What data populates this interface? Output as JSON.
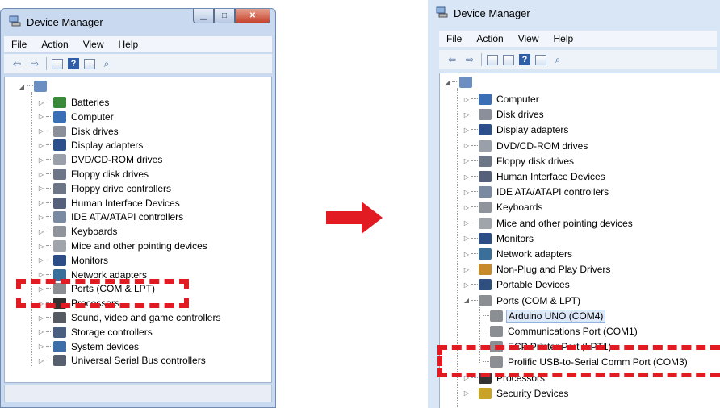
{
  "window": {
    "title": "Device Manager"
  },
  "menu": [
    "File",
    "Action",
    "View",
    "Help"
  ],
  "left_tree": {
    "items": [
      {
        "label": "Batteries",
        "icon": "battery-icon"
      },
      {
        "label": "Computer",
        "icon": "computer-icon"
      },
      {
        "label": "Disk drives",
        "icon": "disk-drive-icon"
      },
      {
        "label": "Display adapters",
        "icon": "display-adapter-icon"
      },
      {
        "label": "DVD/CD-ROM drives",
        "icon": "dvd-drive-icon"
      },
      {
        "label": "Floppy disk drives",
        "icon": "floppy-drive-icon"
      },
      {
        "label": "Floppy drive controllers",
        "icon": "floppy-controller-icon"
      },
      {
        "label": "Human Interface Devices",
        "icon": "hid-icon"
      },
      {
        "label": "IDE ATA/ATAPI controllers",
        "icon": "ide-controller-icon"
      },
      {
        "label": "Keyboards",
        "icon": "keyboard-icon"
      },
      {
        "label": "Mice and other pointing devices",
        "icon": "mouse-icon"
      },
      {
        "label": "Monitors",
        "icon": "monitor-icon"
      },
      {
        "label": "Network adapters",
        "icon": "network-adapter-icon"
      },
      {
        "label": "Ports (COM & LPT)",
        "icon": "port-icon"
      },
      {
        "label": "Processors",
        "icon": "processor-icon"
      },
      {
        "label": "Sound, video and game controllers",
        "icon": "sound-icon"
      },
      {
        "label": "Storage controllers",
        "icon": "storage-controller-icon"
      },
      {
        "label": "System devices",
        "icon": "system-devices-icon"
      },
      {
        "label": "Universal Serial Bus controllers",
        "icon": "usb-icon"
      }
    ]
  },
  "right_tree": {
    "items": [
      {
        "label": "Computer",
        "icon": "computer-icon"
      },
      {
        "label": "Disk drives",
        "icon": "disk-drive-icon"
      },
      {
        "label": "Display adapters",
        "icon": "display-adapter-icon"
      },
      {
        "label": "DVD/CD-ROM drives",
        "icon": "dvd-drive-icon"
      },
      {
        "label": "Floppy disk drives",
        "icon": "floppy-drive-icon"
      },
      {
        "label": "Human Interface Devices",
        "icon": "hid-icon"
      },
      {
        "label": "IDE ATA/ATAPI controllers",
        "icon": "ide-controller-icon"
      },
      {
        "label": "Keyboards",
        "icon": "keyboard-icon"
      },
      {
        "label": "Mice and other pointing devices",
        "icon": "mouse-icon"
      },
      {
        "label": "Monitors",
        "icon": "monitor-icon"
      },
      {
        "label": "Network adapters",
        "icon": "network-adapter-icon"
      },
      {
        "label": "Non-Plug and Play Drivers",
        "icon": "driver-icon"
      },
      {
        "label": "Portable Devices",
        "icon": "portable-device-icon"
      },
      {
        "label": "Ports (COM & LPT)",
        "icon": "port-icon"
      }
    ],
    "ports_children": [
      {
        "label": "Arduino UNO (COM4)",
        "selected": true
      },
      {
        "label": "Communications Port (COM1)",
        "selected": false
      },
      {
        "label": "ECP Printer Port (LPT1)",
        "selected": false
      },
      {
        "label": "Prolific USB-to-Serial Comm Port (COM3)",
        "selected": false
      }
    ],
    "after_items": [
      {
        "label": "Processors",
        "icon": "processor-icon"
      },
      {
        "label": "Security Devices",
        "icon": "security-device-icon"
      }
    ]
  },
  "colors": {
    "highlight": "#e21b22",
    "selection": "#dde9f8",
    "window_frame": "#c9daf0"
  }
}
